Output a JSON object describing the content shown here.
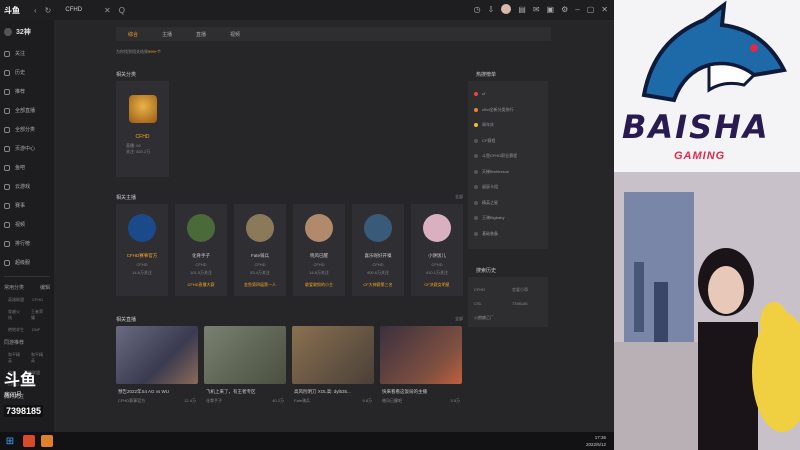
{
  "titlebar": {
    "logo": "斗鱼",
    "nav_back": "‹",
    "nav_refresh": "↻",
    "tab_label": "CFHD",
    "close": "✕",
    "search": "Q"
  },
  "sidebar": {
    "profile_name": "32神",
    "items": [
      {
        "label": "关注",
        "icon": "heart-icon"
      },
      {
        "label": "历史",
        "icon": "history-icon"
      },
      {
        "label": "推荐",
        "icon": "home-icon"
      },
      {
        "label": "全部直播",
        "icon": "grid-icon"
      },
      {
        "label": "全部分类",
        "icon": "list-icon"
      },
      {
        "label": "页游中心",
        "icon": "gamepad-icon"
      },
      {
        "label": "鱼吧",
        "icon": "fish-icon"
      },
      {
        "label": "云游戏",
        "icon": "cloud-icon"
      },
      {
        "label": "赛事",
        "icon": "trophy-icon"
      },
      {
        "label": "视频",
        "icon": "video-icon"
      },
      {
        "label": "排行榜",
        "icon": "rank-icon"
      },
      {
        "label": "超级服",
        "icon": "server-icon"
      }
    ],
    "group1_title": "常用分类",
    "group1_more": "编辑",
    "group1_subs": [
      [
        "英雄联盟",
        "CFHD"
      ],
      [
        "穿越火线",
        "王者荣耀"
      ],
      [
        "绝地求生",
        "DNF"
      ]
    ],
    "group2_title": "同游推荐",
    "group2_subs": [
      [
        "和平精英",
        "和平精英"
      ],
      [
        "交友",
        "英雄联盟"
      ],
      [
        "CFHD",
        "DNF"
      ]
    ],
    "group3_title": "我的关注",
    "brand_big": "斗鱼",
    "brand_room": "房间号",
    "brand_count": "7398185"
  },
  "main": {
    "tabs": [
      "综合",
      "主播",
      "直播",
      "视频"
    ],
    "notice_prefix": "为你找到相关结果",
    "notice_count": "999+个",
    "cat_section_title": "相关分类",
    "category": {
      "name": "CFHD",
      "line1": "直播: 92",
      "line2": "关注: 820.2万"
    },
    "anchor_section_title": "相关主播",
    "anchor_section_more": "全部",
    "anchors": [
      {
        "name": "CFHD赛事官方",
        "game": "CFHD",
        "fans": "14.6万关注",
        "btn": "",
        "color": "#1a4a8a"
      },
      {
        "name": "化骨手子",
        "game": "CFHD",
        "fans": "101.5万关注",
        "btn": "CFHD直播大赛",
        "color": "#4a6a3a"
      },
      {
        "name": "Fate骑兵",
        "game": "CFHD",
        "fans": "53.4万关注",
        "btn": "金鱼第四届第一人",
        "color": "#8a7a5a"
      },
      {
        "name": "晓风已醒",
        "game": "CFHD",
        "fans": "14.8万关注",
        "btn": "敢爱敢恨的小主",
        "color": "#b08a6a"
      },
      {
        "name": "喜乐呢好开嗓",
        "game": "CFHD",
        "fans": "409.6万关注",
        "btn": "CF大神赛第三名",
        "color": "#3a5a7a"
      },
      {
        "name": "小饼饭儿",
        "game": "CFHD",
        "fans": "410.1万关注",
        "btn": "CF决赛女明星",
        "color": "#d8b0c0"
      }
    ],
    "live_section_title": "相关直播",
    "live_section_more": "全部",
    "lives": [
      {
        "title": "预告2022年S4 AG vs WU",
        "meta": "CFHD赛事官方",
        "views": "12.4万",
        "bg": "linear-gradient(135deg,#6a6a80,#3a3a50 60%,#8a6a5a)"
      },
      {
        "title": "飞机上来了，有王者专区",
        "meta": "化骨手子",
        "views": "40.2万",
        "bg": "linear-gradient(135deg,#7a8070,#4a5040)"
      },
      {
        "title": "高风险明刀 XOL高: dyl535...",
        "meta": "Fate骑兵",
        "views": "9.8万",
        "bg": "linear-gradient(135deg,#8a7050,#4a4038)"
      },
      {
        "title": "快来看看这饭局的主播",
        "meta": "晓风已醒吧",
        "views": "3.5万",
        "bg": "linear-gradient(135deg,#3a3040,#805040 70%,#c06040)"
      }
    ],
    "hot_title": "热搜榜单",
    "hot_items": [
      {
        "text": "cf",
        "color": "#e04848"
      },
      {
        "text": "cfhd全新分类排行",
        "color": "#f08030"
      },
      {
        "text": "周年庆",
        "color": "#f0c030"
      },
      {
        "text": "CF赛程",
        "color": "#555555"
      },
      {
        "text": "斗鱼CFHD职业赛程",
        "color": "#555555"
      },
      {
        "text": "天梯Bmhiresue",
        "color": "#555555"
      },
      {
        "text": "诞辰卡组",
        "color": "#555555"
      },
      {
        "text": "精英之星",
        "color": "#555555"
      },
      {
        "text": "王骑Bigbaby",
        "color": "#555555"
      },
      {
        "text": "基础装备",
        "color": "#555555"
      }
    ],
    "search_title": "搜索历史",
    "search_items": [
      "CFHD",
      "恋爱小哥",
      "CSL",
      "7398185",
      "火麒麟乙厂"
    ]
  },
  "taskbar": {
    "time": "17:36",
    "date": "2022/6/12"
  },
  "overlay": {
    "brand_text": "BAISHA",
    "brand_sub": "GAMING",
    "accent": "#e02a4a",
    "brand_color": "#2a1a52"
  }
}
